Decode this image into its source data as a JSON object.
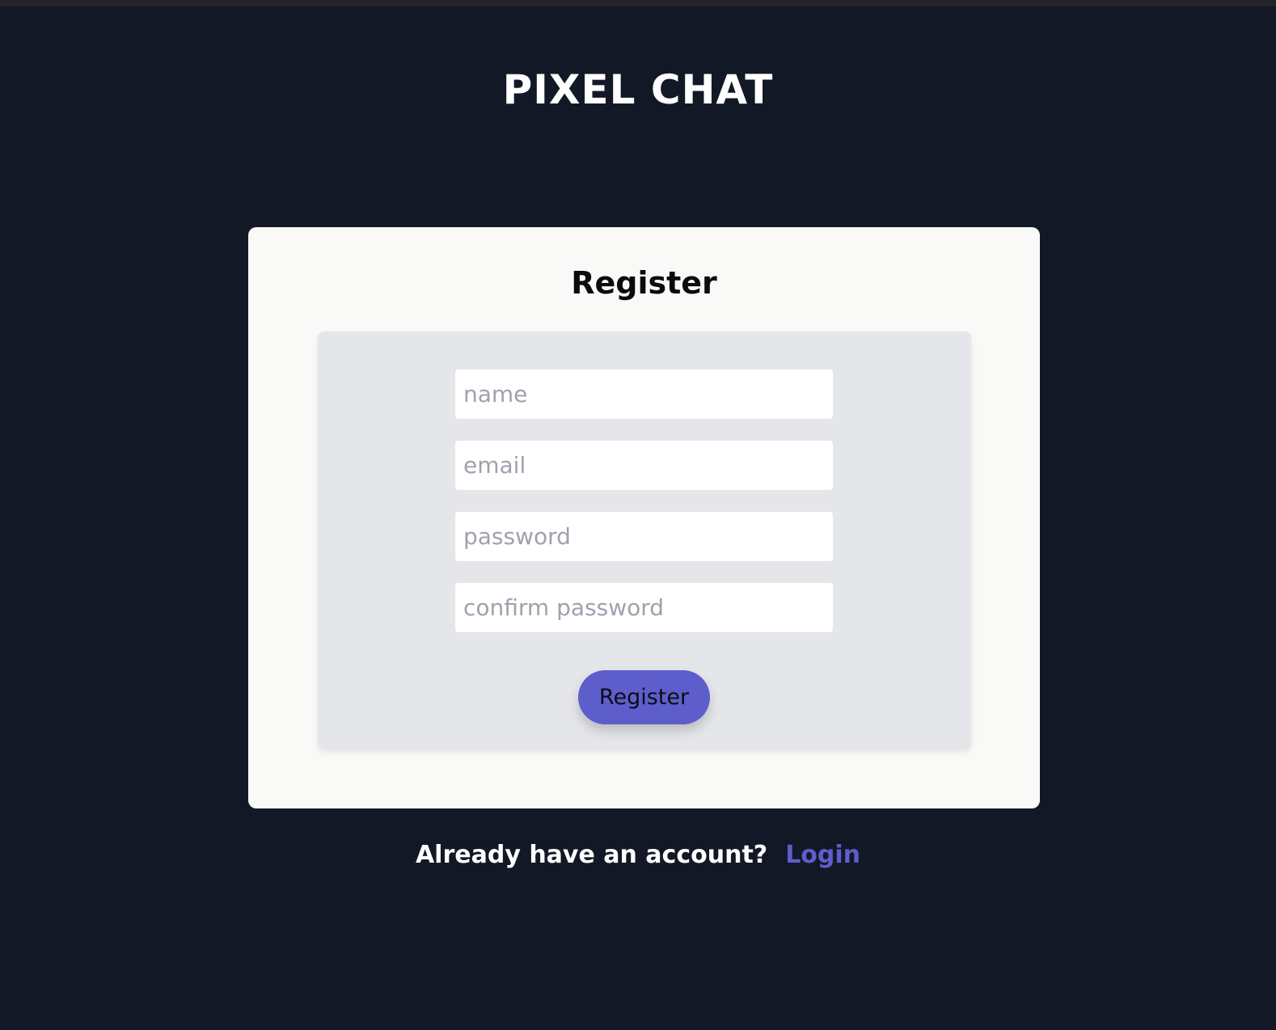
{
  "app": {
    "title": "PIXEL CHAT"
  },
  "register_form": {
    "heading": "Register",
    "fields": {
      "name": {
        "placeholder": "name",
        "value": ""
      },
      "email": {
        "placeholder": "email",
        "value": ""
      },
      "password": {
        "placeholder": "password",
        "value": ""
      },
      "confirm_password": {
        "placeholder": "confirm password",
        "value": ""
      }
    },
    "submit_label": "Register"
  },
  "footer": {
    "prompt": "Already have an account?",
    "login_link": "Login"
  },
  "colors": {
    "background": "#131826",
    "card": "#f9f9f7",
    "panel": "#e5e6ea",
    "accent": "#5d5ecc"
  }
}
